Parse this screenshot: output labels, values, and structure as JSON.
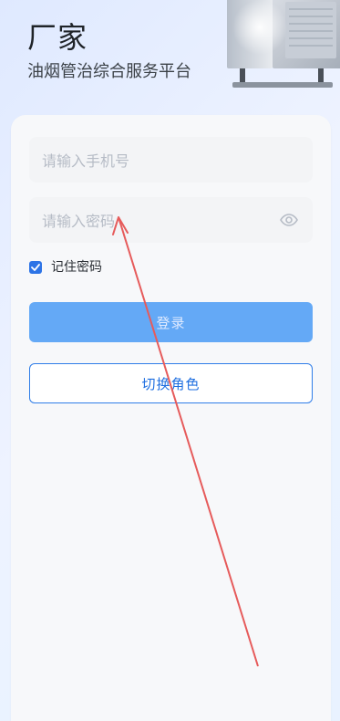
{
  "header": {
    "title": "厂家",
    "subtitle": "油烟管治综合服务平台"
  },
  "form": {
    "phone": {
      "placeholder": "请输入手机号",
      "value": ""
    },
    "password": {
      "placeholder": "请输入密码",
      "value": ""
    },
    "remember": {
      "label": "记住密码",
      "checked": true
    },
    "login_label": "登录",
    "switch_role_label": "切换角色"
  },
  "icons": {
    "eye": "eye-icon",
    "checkmark": "checkmark-icon"
  },
  "colors": {
    "primary": "#2f7de8",
    "login_button": "#64a9f6",
    "annotation_arrow": "#e65b5b"
  }
}
